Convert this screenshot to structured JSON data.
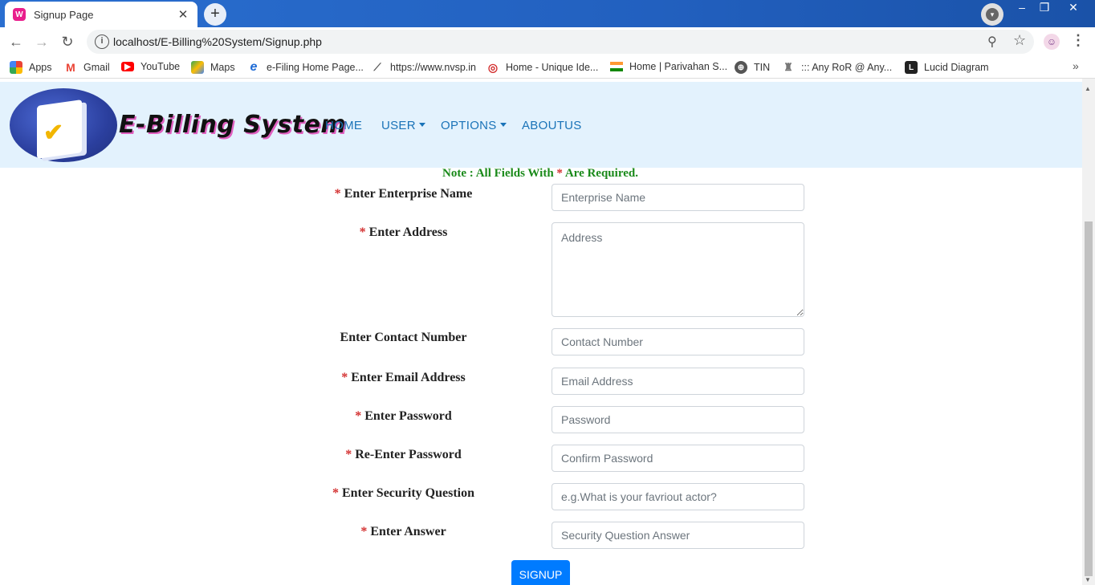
{
  "browser": {
    "tab_title": "Signup Page",
    "tab_favicon": "W",
    "url": "localhost/E-Billing%20System/Signup.php",
    "bookmarks": [
      {
        "label": "Apps",
        "icon": "apps-grid-icon",
        "color": "#4285f4"
      },
      {
        "label": "Gmail",
        "icon": "gmail-icon",
        "color": "#ea4335"
      },
      {
        "label": "YouTube",
        "icon": "youtube-icon",
        "color": "#ff0000"
      },
      {
        "label": "Maps",
        "icon": "maps-icon",
        "color": "#34a853"
      },
      {
        "label": "e-Filing Home Page...",
        "icon": "ie-icon",
        "color": "#1e6bd6"
      },
      {
        "label": "https://www.nvsp.in",
        "icon": "nvsp-icon",
        "color": "#555555"
      },
      {
        "label": "Home - Unique Ide...",
        "icon": "aadhaar-icon",
        "color": "#d32f2f"
      },
      {
        "label": "Home | Parivahan S...",
        "icon": "india-flag-icon",
        "color": "#ff9933"
      },
      {
        "label": "TIN",
        "icon": "globe-icon",
        "color": "#444444"
      },
      {
        "label": "::: Any RoR @ Any...",
        "icon": "emblem-icon",
        "color": "#777777"
      },
      {
        "label": "Lucid Diagram",
        "icon": "lucid-icon",
        "color": "#222222"
      }
    ]
  },
  "site": {
    "brand": "E-Billing System",
    "nav": {
      "home": "HOME",
      "user": "USER",
      "options": "OPTIONS",
      "aboutus": "ABOUTUS"
    }
  },
  "form": {
    "note_prefix": "Note : All Fields With ",
    "note_star": "*",
    "note_suffix": " Are Required.",
    "star": "*",
    "fields": [
      {
        "label": "Enter Enterprise Name",
        "required": true,
        "placeholder": "Enterprise Name"
      },
      {
        "label": "Enter Address",
        "required": true,
        "placeholder": "Address"
      },
      {
        "label": "Enter Contact Number",
        "required": false,
        "placeholder": "Contact Number"
      },
      {
        "label": "Enter Email Address",
        "required": true,
        "placeholder": "Email Address"
      },
      {
        "label": "Enter Password",
        "required": true,
        "placeholder": "Password"
      },
      {
        "label": "Re-Enter Password",
        "required": true,
        "placeholder": "Confirm Password"
      },
      {
        "label": "Enter Security Question",
        "required": true,
        "placeholder": "e.g.What is your favriout actor?"
      },
      {
        "label": "Enter Answer",
        "required": true,
        "placeholder": "Security Question Answer"
      }
    ],
    "submit_label": "SIGNUP"
  }
}
